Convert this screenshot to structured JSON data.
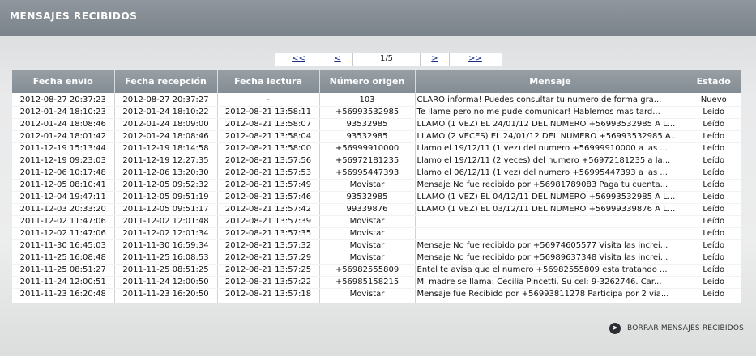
{
  "header": {
    "title": "MENSAJES RECIBIDOS"
  },
  "pager": {
    "first": "<<",
    "prev": "<",
    "current": "1/5",
    "next": ">",
    "last": ">>"
  },
  "table": {
    "columns": [
      "Fecha envio",
      "Fecha recepción",
      "Fecha lectura",
      "Número origen",
      "Mensaje",
      "Estado"
    ],
    "rows": [
      [
        "2012-08-27 20:37:23",
        "2012-08-27 20:37:27",
        "-",
        "103",
        "CLARO informa! Puedes consultar tu numero de forma gra...",
        "Nuevo"
      ],
      [
        "2012-01-24 18:10:23",
        "2012-01-24 18:10:22",
        "2012-08-21 13:58:11",
        "+56993532985",
        "Te llame pero no me pude comunicar! Hablemos mas tard...",
        "Leído"
      ],
      [
        "2012-01-24 18:08:46",
        "2012-01-24 18:09:00",
        "2012-08-21 13:58:07",
        "93532985",
        "LLAMO (1 VEZ) EL 24/01/12 DEL NUMERO +56993532985 A L...",
        "Leído"
      ],
      [
        "2012-01-24 18:01:42",
        "2012-01-24 18:08:46",
        "2012-08-21 13:58:04",
        "93532985",
        "LLAMO (2 VECES) EL 24/01/12 DEL NUMERO +56993532985 A...",
        "Leído"
      ],
      [
        "2011-12-19 15:13:44",
        "2011-12-19 18:14:58",
        "2012-08-21 13:58:00",
        "+56999910000",
        "Llamo el 19/12/11 (1 vez) del numero +56999910000 a las ...",
        "Leído"
      ],
      [
        "2011-12-19 09:23:03",
        "2011-12-19 12:27:35",
        "2012-08-21 13:57:56",
        "+56972181235",
        "Llamo el 19/12/11 (2 veces) del numero +56972181235 a la...",
        "Leído"
      ],
      [
        "2011-12-06 10:17:48",
        "2011-12-06 13:20:30",
        "2012-08-21 13:57:53",
        "+56995447393",
        "Llamo el 06/12/11 (1 vez) del numero +56995447393 a las ...",
        "Leído"
      ],
      [
        "2011-12-05 08:10:41",
        "2011-12-05 09:52:32",
        "2012-08-21 13:57:49",
        "Movistar",
        "Mensaje No fue recibido por +56981789083 Paga tu cuenta...",
        "Leído"
      ],
      [
        "2011-12-04 19:47:11",
        "2011-12-05 09:51:19",
        "2012-08-21 13:57:46",
        "93532985",
        "LLAMO (1 VEZ) EL 04/12/11 DEL NUMERO +56993532985 A L...",
        "Leído"
      ],
      [
        "2011-12-03 20:33:20",
        "2011-12-05 09:51:17",
        "2012-08-21 13:57:42",
        "99339876",
        "LLAMO (1 VEZ) EL 03/12/11 DEL NUMERO +56999339876 A L...",
        "Leído"
      ],
      [
        "2011-12-02 11:47:06",
        "2011-12-02 12:01:48",
        "2012-08-21 13:57:39",
        "Movistar",
        "",
        "Leído"
      ],
      [
        "2011-12-02 11:47:06",
        "2011-12-02 12:01:34",
        "2012-08-21 13:57:35",
        "Movistar",
        "",
        "Leído"
      ],
      [
        "2011-11-30 16:45:03",
        "2011-11-30 16:59:34",
        "2012-08-21 13:57:32",
        "Movistar",
        "Mensaje No fue recibido por +56974605577 Visita las increi...",
        "Leído"
      ],
      [
        "2011-11-25 16:08:48",
        "2011-11-25 16:08:53",
        "2012-08-21 13:57:29",
        "Movistar",
        "Mensaje No fue recibido por +56989637348 Visita las increi...",
        "Leído"
      ],
      [
        "2011-11-25 08:51:27",
        "2011-11-25 08:51:25",
        "2012-08-21 13:57:25",
        "+56982555809",
        "Entel te avisa que el numero +56982555809 esta tratando ...",
        "Leído"
      ],
      [
        "2011-11-24 12:00:51",
        "2011-11-24 12:00:50",
        "2012-08-21 13:57:22",
        "+56985158215",
        "Mi madre se llama: Cecilia Pincetti. Su cel: 9-3262746. Car...",
        "Leído"
      ],
      [
        "2011-11-23 16:20:48",
        "2011-11-23 16:20:50",
        "2012-08-21 13:57:18",
        "Movistar",
        "Mensaje fue Recibido por +56993811278 Participa por 2 via...",
        "Leído"
      ]
    ]
  },
  "footer": {
    "delete_label": "BORRAR MENSAJES RECIBIDOS",
    "delete_icon": "arrow-right-circle-icon"
  }
}
